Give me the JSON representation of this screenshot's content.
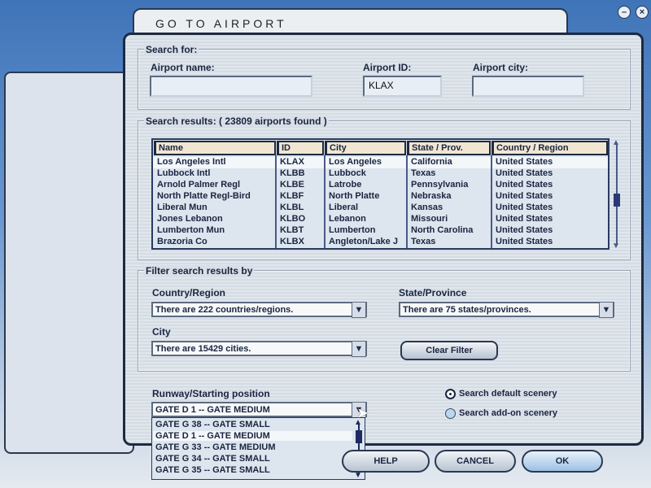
{
  "window": {
    "title": "GO TO AIRPORT",
    "minimize": "–",
    "close": "×"
  },
  "search": {
    "legend": "Search for:",
    "name_label": "Airport name:",
    "name_value": "",
    "id_label": "Airport ID:",
    "id_value": "KLAX",
    "city_label": "Airport city:",
    "city_value": ""
  },
  "results": {
    "legend": "Search results: ( 23809 airports found )",
    "columns": [
      "Name",
      "ID",
      "City",
      "State / Prov.",
      "Country / Region"
    ],
    "rows": [
      [
        "Los Angeles Intl",
        "KLAX",
        "Los Angeles",
        "California",
        "United States"
      ],
      [
        "Lubbock Intl",
        "KLBB",
        "Lubbock",
        "Texas",
        "United States"
      ],
      [
        "Arnold Palmer Regl",
        "KLBE",
        "Latrobe",
        "Pennsylvania",
        "United States"
      ],
      [
        "North Platte Regl-Bird",
        "KLBF",
        "North Platte",
        "Nebraska",
        "United States"
      ],
      [
        "Liberal Mun",
        "KLBL",
        "Liberal",
        "Kansas",
        "United States"
      ],
      [
        "Jones Lebanon",
        "KLBO",
        "Lebanon",
        "Missouri",
        "United States"
      ],
      [
        "Lumberton Mun",
        "KLBT",
        "Lumberton",
        "North Carolina",
        "United States"
      ],
      [
        "Brazoria Co",
        "KLBX",
        "Angleton/Lake J",
        "Texas",
        "United States"
      ]
    ]
  },
  "filter": {
    "legend": "Filter search results by",
    "country_label": "Country/Region",
    "country_value": "There are 222 countries/regions.",
    "state_label": "State/Province",
    "state_value": "There are 75 states/provinces.",
    "city_label": "City",
    "city_value": "There are 15429 cities.",
    "clear_label": "Clear Filter"
  },
  "runway": {
    "label": "Runway/Starting position",
    "value": "GATE D 1 -- GATE MEDIUM",
    "options": [
      "GATE G 38 -- GATE SMALL",
      "GATE D 1 -- GATE MEDIUM",
      "GATE G 33 -- GATE MEDIUM",
      "GATE G 34 -- GATE SMALL",
      "GATE G 35 -- GATE SMALL"
    ]
  },
  "scenery": {
    "default_label": "Search default scenery",
    "addon_label": "Search add-on scenery"
  },
  "buttons": {
    "help": "HELP",
    "cancel": "CANCEL",
    "ok": "OK"
  }
}
